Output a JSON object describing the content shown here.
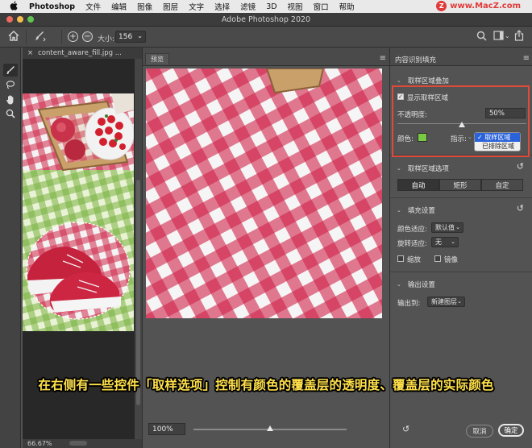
{
  "menubar": {
    "app_name": "Photoshop",
    "items": [
      "文件",
      "编辑",
      "图像",
      "图层",
      "文字",
      "选择",
      "滤镜",
      "3D",
      "视图",
      "窗口",
      "帮助"
    ],
    "watermark": "www.MacZ.com"
  },
  "window": {
    "title": "Adobe Photoshop 2020"
  },
  "options_bar": {
    "size_label": "大小:",
    "size_value": "156"
  },
  "document": {
    "tab_name": "content_aware_fill.jpg ...",
    "zoom": "66.67%"
  },
  "preview": {
    "tab_label": "预览",
    "zoom_value": "100%",
    "zoom_slider_percent": 50
  },
  "panel": {
    "title": "内容识别填充",
    "sampling_overlay": {
      "heading": "取样区域叠加",
      "show_label": "显示取样区域",
      "show_checked": true,
      "opacity_label": "不透明度:",
      "opacity_value": "50%",
      "opacity_fraction": 0.5,
      "color_label": "颜色:",
      "color_value": "#7ac943",
      "indicate_label": "指示:",
      "indicate_options": [
        "取样区域",
        "已排除区域"
      ],
      "indicate_selected": "取样区域"
    },
    "sampling_options": {
      "heading": "取样区域选项",
      "modes": [
        "自动",
        "矩形",
        "自定"
      ],
      "active_mode": "自动"
    },
    "fill_settings": {
      "heading": "填充设置",
      "color_adapt_label": "颜色适应:",
      "color_adapt_value": "默认值",
      "rotation_label": "旋转适应:",
      "rotation_value": "无",
      "scale_label": "缩放",
      "mirror_label": "镜像"
    },
    "output": {
      "heading": "输出设置",
      "output_label": "输出到:",
      "output_value": "新建图层"
    },
    "buttons": {
      "cancel": "取消",
      "ok": "确定"
    }
  },
  "caption": "在右侧有一些控件「取样选项」控制有颜色的覆盖层的透明度、覆盖层的实际颜色"
}
